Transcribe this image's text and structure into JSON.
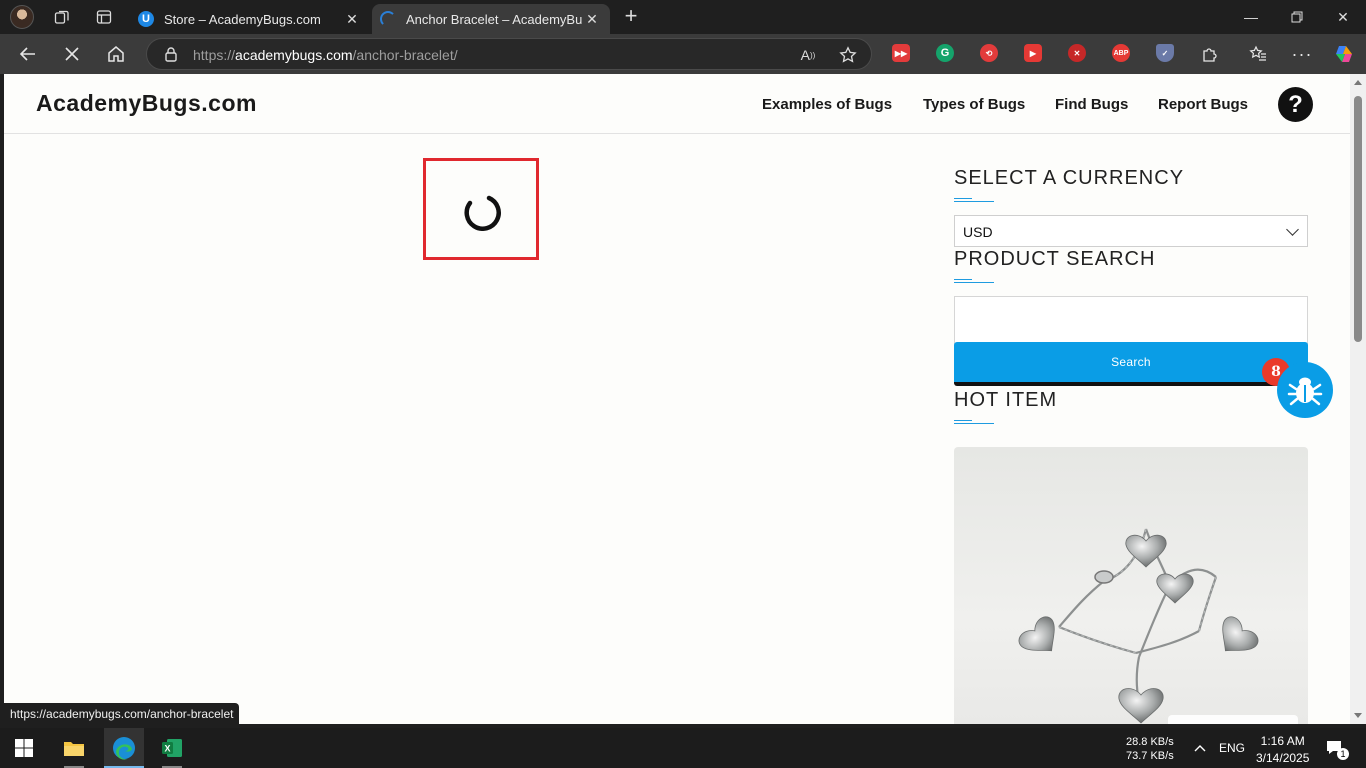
{
  "browser": {
    "tabs": [
      {
        "title": "Store – AcademyBugs.com",
        "active": false
      },
      {
        "title": "Anchor Bracelet – AcademyBugs.com",
        "active": true
      }
    ],
    "address": {
      "host": "academybugs.com",
      "path": "/anchor-bracelet/",
      "scheme": "https://"
    },
    "status_url": "https://academybugs.com/anchor-bracelet"
  },
  "site": {
    "logo": "AcademyBugs.com",
    "nav": [
      "Examples of Bugs",
      "Types of Bugs",
      "Find Bugs",
      "Report Bugs"
    ],
    "help_glyph": "?"
  },
  "sidebar": {
    "currency_heading": "SELECT A CURRENCY",
    "currency_value": "USD",
    "search_heading": "PRODUCT SEARCH",
    "search_button": "Search",
    "hot_heading": "HOT ITEM"
  },
  "bug_widget": {
    "count": "8"
  },
  "taskbar": {
    "net_down": "28.8 KB/s",
    "net_up": "73.7 KB/s",
    "lang": "ENG",
    "time": "1:16 AM",
    "date": "3/14/2025",
    "notif_count": "1"
  },
  "colors": {
    "accent": "#0a9de6",
    "highlight_box": "#e0282e",
    "badge": "#ea3a2a"
  }
}
